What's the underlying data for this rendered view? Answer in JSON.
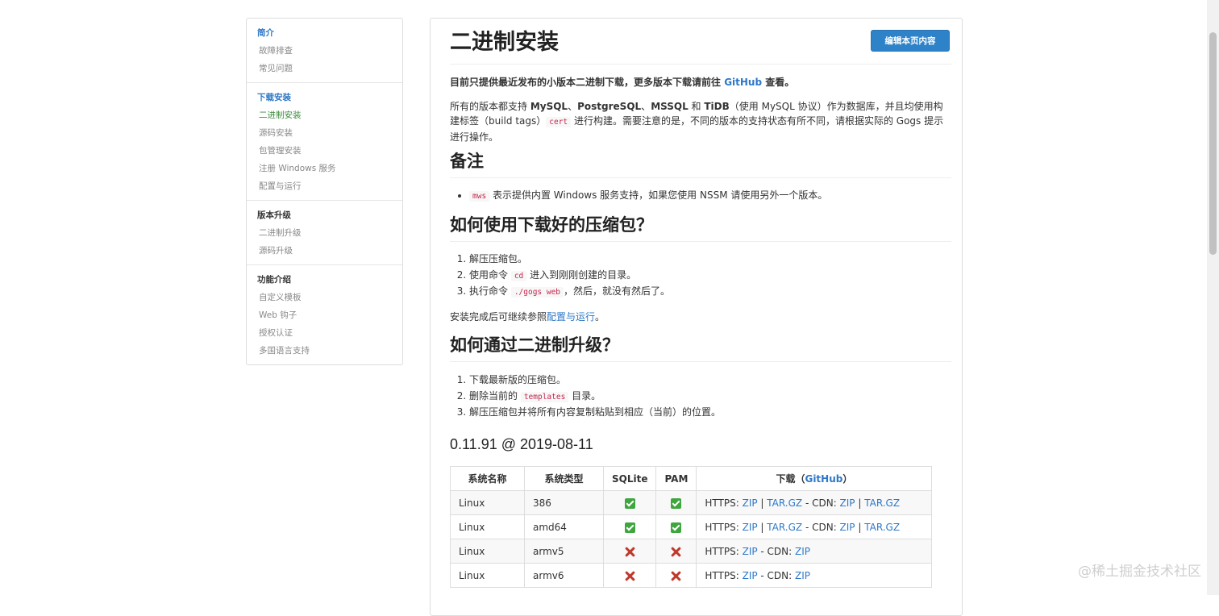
{
  "sidebar": {
    "sections": [
      {
        "head": "简介",
        "items": [
          "故障排查",
          "常见问题"
        ]
      },
      {
        "head": "下载安装",
        "items": [
          "二进制安装",
          "源码安装",
          "包管理安装",
          "注册 Windows 服务",
          "配置与运行"
        ]
      },
      {
        "head": "版本升级",
        "items": [
          "二进制升级",
          "源码升级"
        ]
      },
      {
        "head": "功能介绍",
        "items": [
          "自定义模板",
          "Web 钩子",
          "授权认证",
          "多国语言支持"
        ]
      }
    ]
  },
  "main": {
    "title": "二进制安装",
    "edit_button": "编辑本页内容",
    "intro": {
      "text1": "目前只提供最近发布的小版本二进制下载，更多版本下载请前往 ",
      "link": "GitHub",
      "text2": " 查看。"
    },
    "intro2": {
      "text1": "所有的版本都支持 ",
      "db1": "MySQL",
      "sep1": "、",
      "db2": "PostgreSQL",
      "sep2": "、",
      "db3": "MSSQL",
      "and": " 和 ",
      "db4": "TiDB",
      "text2": "（使用 MySQL 协议）作为数据库，并且均使用构建标签（build tags）",
      "code": "cert",
      "text3": " 进行构建。需要注意的是，不同的版本的支持状态有所不同，请根据实际的 Gogs 提示进行操作。"
    },
    "notes": {
      "heading": "备注",
      "item_code": "mws",
      "item_text": " 表示提供内置 Windows 服务支持，如果您使用 NSSM 请使用另外一个版本。"
    },
    "howto": {
      "heading": "如何使用下载好的压缩包？",
      "step1": "解压压缩包。",
      "step2_pre": "使用命令 ",
      "step2_code": "cd",
      "step2_post": " 进入到刚刚创建的目录。",
      "step3_pre": "执行命令 ",
      "step3_code": "./gogs web",
      "step3_post": "，然后，就没有然后了。",
      "after_pre": "安装完成后可继续参照",
      "after_link": "配置与运行",
      "after_post": "。"
    },
    "upgrade": {
      "heading": "如何通过二进制升级？",
      "step1": "下载最新版的压缩包。",
      "step2_pre": "删除当前的 ",
      "step2_code": "templates",
      "step2_post": " 目录。",
      "step3": "解压压缩包并将所有内容复制粘贴到相应（当前）的位置。"
    },
    "version": "0.11.91 @ 2019-08-11",
    "table": {
      "headers": {
        "name": "系统名称",
        "type": "系统类型",
        "sqlite": "SQLite",
        "pam": "PAM",
        "dl_pre": "下载（",
        "dl_link": "GitHub",
        "dl_post": "）"
      },
      "https": "HTTPS: ",
      "cdn": " - CDN: ",
      "zip": "ZIP",
      "targz": "TAR.GZ",
      "pipe": " | ",
      "rows": [
        {
          "os": "Linux",
          "arch": "386",
          "sqlite": true,
          "pam": true,
          "targz": true
        },
        {
          "os": "Linux",
          "arch": "amd64",
          "sqlite": true,
          "pam": true,
          "targz": true
        },
        {
          "os": "Linux",
          "arch": "armv5",
          "sqlite": false,
          "pam": false,
          "targz": false
        },
        {
          "os": "Linux",
          "arch": "armv6",
          "sqlite": false,
          "pam": false,
          "targz": false
        }
      ]
    }
  },
  "watermark": "@稀土掘金技术社区"
}
